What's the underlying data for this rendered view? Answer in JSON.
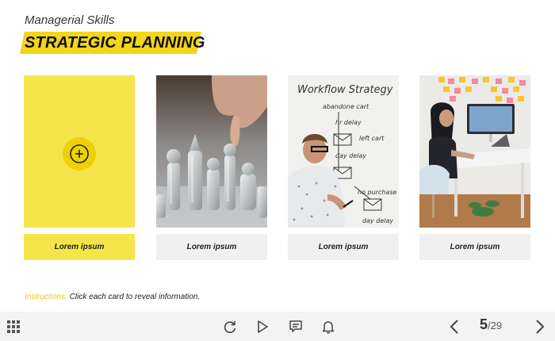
{
  "header": {
    "subtitle": "Managerial Skills",
    "title": "STRATEGIC PLANNING"
  },
  "cards": [
    {
      "label": "Lorem ipsum",
      "state": "active",
      "icon": "plus-circle-icon"
    },
    {
      "label": "Lorem ipsum",
      "image": "chess-pieces-photo"
    },
    {
      "label": "Lorem ipsum",
      "image": "whiteboard-workflow-photo",
      "whiteboard": {
        "heading": "Workflow Strategy",
        "lines": [
          "abandone cart",
          "hr delay",
          "left cart",
          "day delay",
          "no purchase",
          "day delay"
        ]
      }
    },
    {
      "label": "Lorem ipsum",
      "image": "office-desk-photo"
    }
  ],
  "instructions": {
    "label": "Instructions:",
    "text": " Click each card to reveal information."
  },
  "toolbar": {
    "menu_icon": "grid-menu-icon",
    "replay_icon": "replay-icon",
    "play_icon": "play-icon",
    "captions_icon": "captions-icon",
    "notifications_icon": "bell-icon",
    "prev_icon": "chevron-left-icon",
    "next_icon": "chevron-right-icon",
    "current_page": "5",
    "separator": "/",
    "total_pages": "29"
  },
  "colors": {
    "accent": "#f2d61a",
    "card_active": "#f5e54a",
    "instructions_label": "#f2c40f",
    "toolbar_bg": "#f3f3f3"
  }
}
